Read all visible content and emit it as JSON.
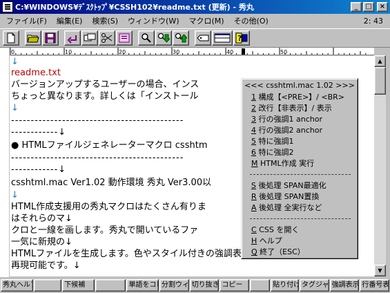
{
  "window": {
    "title": "C:¥WINDOWS¥ﾃﾞｽｸﾄｯﾌﾟ¥CSSH102¥readme.txt (更新) - 秀丸",
    "minimize": "_",
    "maximize": "□",
    "close": "×"
  },
  "menu": {
    "items": [
      "ファイル(F)",
      "編集(E)",
      "検索(S)",
      "ウィンドウ(W)",
      "マクロ(M)",
      "その他(O)"
    ],
    "clock": "2: 43"
  },
  "toolbar": {
    "icons": [
      "new-file-icon",
      "open-folder-icon",
      "save-icon",
      "undo-icon",
      "copy-icon",
      "cut-icon",
      "paste-icon",
      "search-icon",
      "search-down-icon",
      "search-up-icon",
      "tag-icon",
      "window-split-icon",
      "help-icon"
    ]
  },
  "ruler": {
    "labels": [
      "0",
      "10",
      "20",
      "30",
      "40",
      "50"
    ]
  },
  "editor": {
    "lines": [
      "↓",
      "readme.txt",
      "バージョンアップするユーザーの場合、インス",
      "ちょっと異なります。詳しくは「インストール",
      "↓",
      "--------------------------------------------",
      "------------↓",
      "● HTMLファイルジェネレーターマクロ csshtm",
      "--------------------------------------------",
      "------------↓",
      "csshtml.mac Ver1.02 動作環境 秀丸 Ver3.00以",
      "↓",
      "HTML作成支援用の秀丸マクロはたくさん有りま",
      "はそれらのマ↓",
      "クロと一線を画します。秀丸で開いているファ",
      "一気に新規の↓",
      "HTMLファイルを生成します。色やスタイル付きの強調表示文字列が",
      "再現可能です。↓"
    ]
  },
  "popup": {
    "title": "<<< csshtml.mac 1.02 >>>",
    "items": [
      {
        "key": "1",
        "label": " 構成【<PRE>】/ <BR>"
      },
      {
        "key": "2",
        "label": " 改行【非表示】/ 表示"
      },
      {
        "key": "3",
        "label": " 行の強調1 anchor"
      },
      {
        "key": "4",
        "label": " 行の強調2 anchor"
      },
      {
        "key": "5",
        "label": " 特に強調1"
      },
      {
        "key": "6",
        "label": " 特に強調2"
      },
      {
        "key": "M",
        "label": " HTML作成 実行"
      },
      {
        "key": "S",
        "label": " 後処理 SPAN最適化"
      },
      {
        "key": "R",
        "label": " 後処理 SPAN置換"
      },
      {
        "key": "A",
        "label": " 後処理 全実行など"
      },
      {
        "key": "C",
        "label": " CSS を開く"
      },
      {
        "key": "H",
        "label": " ヘルプ"
      },
      {
        "key": "Q",
        "label": " 終了（ESC）"
      }
    ]
  },
  "statusbar": {
    "items": [
      "秀丸ヘルプ",
      "",
      "下候補",
      "",
      "単語をコピ",
      "分割ウィン",
      "切り抜き",
      "コピー",
      "",
      "貼り付け",
      "タグジャンプ",
      "強調表示",
      "行番号表"
    ]
  },
  "colors": {
    "title_start": "#000080",
    "title_end": "#1084d0",
    "return_mark": "#2080c0",
    "filename_red": "#c00000"
  }
}
